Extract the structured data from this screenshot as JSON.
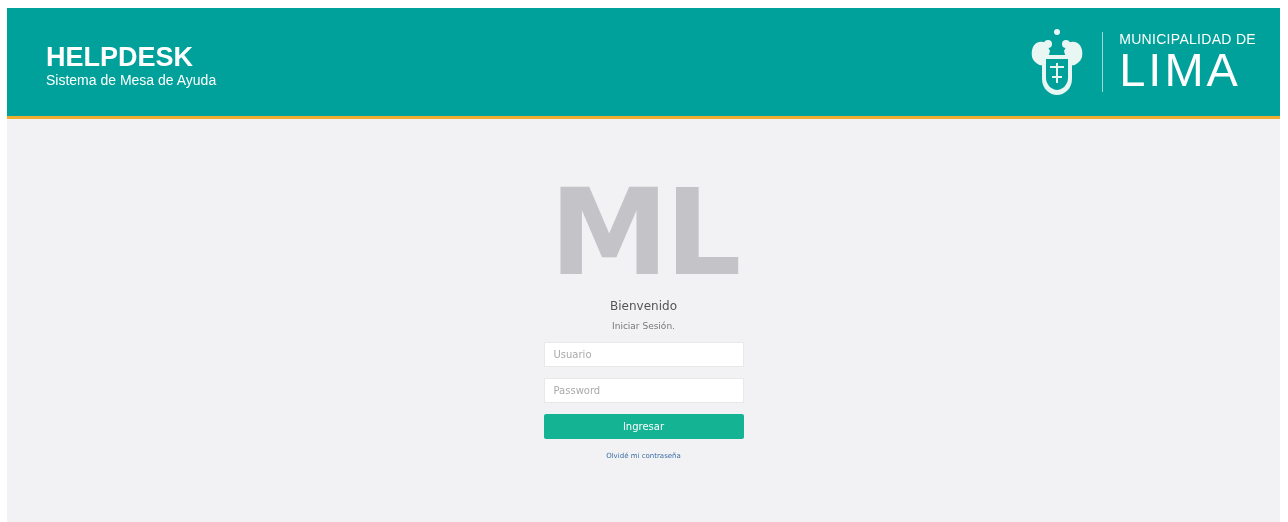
{
  "header": {
    "title": "HELPDESK",
    "subtitle": "Sistema de Mesa de Ayuda",
    "logo": {
      "line_1": "MUNICIPALIDAD DE",
      "line_2": "LIMA"
    }
  },
  "login": {
    "mark": "ML",
    "greeting": "Bienvenido",
    "prompt": "Iniciar Sesión.",
    "fields": [
      {
        "placeholder": "Usuario"
      },
      {
        "placeholder": "Password"
      }
    ],
    "button": "Ingresar",
    "link": "Olvidé mi contraseña"
  }
}
